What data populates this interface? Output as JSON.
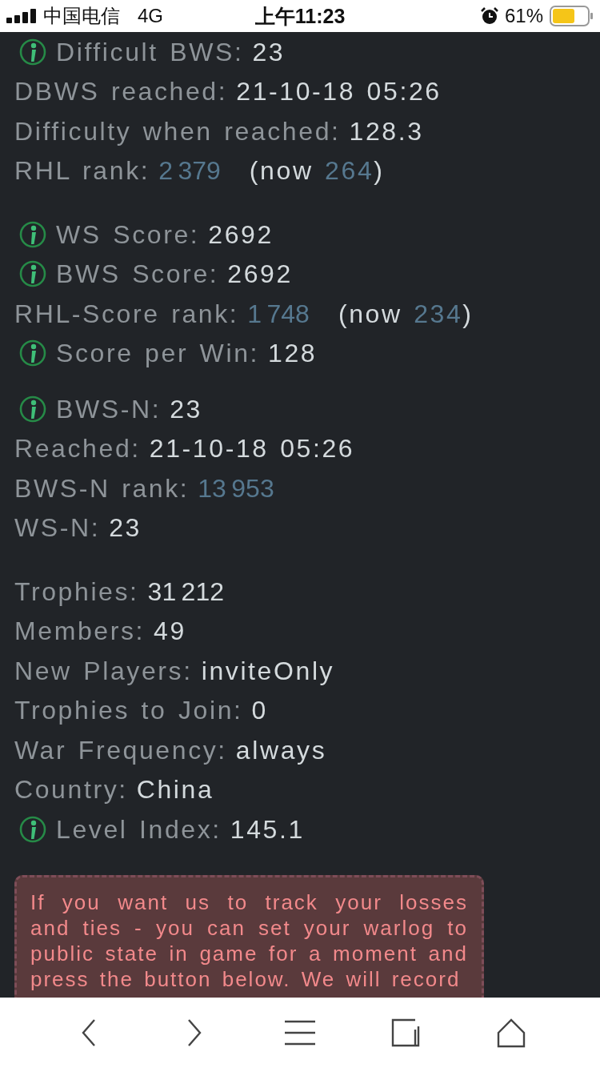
{
  "status_bar": {
    "carrier": "中国电信",
    "network": "4G",
    "time": "上午11:23",
    "battery": "61%"
  },
  "sections": [
    {
      "rows": [
        {
          "kind": "stat",
          "info": true,
          "label": "Difficult BWS:",
          "value": "23"
        },
        {
          "kind": "stat",
          "info": false,
          "label": "DBWS reached:",
          "value": "21-10-18 05:26"
        },
        {
          "kind": "stat",
          "info": false,
          "label": "Difficulty when reached:",
          "value": "128.3"
        },
        {
          "kind": "rank",
          "info": false,
          "label": "RHL rank:",
          "value": "2 379",
          "now_label": "(now",
          "now_value": "264",
          "now_close": ")"
        }
      ]
    },
    {
      "rows": [
        {
          "kind": "stat",
          "info": true,
          "label": "WS Score:",
          "value": "2692"
        },
        {
          "kind": "stat",
          "info": true,
          "label": "BWS Score:",
          "value": "2692"
        },
        {
          "kind": "rank",
          "info": false,
          "label": "RHL-Score rank:",
          "value": "1 748",
          "now_label": "(now",
          "now_value": "234",
          "now_close": ")"
        },
        {
          "kind": "stat",
          "info": true,
          "label": "Score per Win:",
          "value": "128"
        }
      ]
    },
    {
      "rows": [
        {
          "kind": "stat",
          "info": true,
          "label": "BWS-N:",
          "value": "23"
        },
        {
          "kind": "stat",
          "info": false,
          "label": "Reached:",
          "value": "21-10-18 05:26"
        },
        {
          "kind": "rank",
          "info": false,
          "label": "BWS-N rank:",
          "value": "13 953"
        },
        {
          "kind": "stat",
          "info": false,
          "label": "WS-N:",
          "value": "23"
        }
      ]
    },
    {
      "rows": [
        {
          "kind": "stat",
          "info": false,
          "label": "Trophies:",
          "value": "31 212"
        },
        {
          "kind": "stat",
          "info": false,
          "label": "Members:",
          "value": "49"
        },
        {
          "kind": "stat",
          "info": false,
          "label": "New Players:",
          "value": "inviteOnly"
        },
        {
          "kind": "stat",
          "info": false,
          "label": "Trophies to Join:",
          "value": "0"
        },
        {
          "kind": "stat",
          "info": false,
          "label": "War Frequency:",
          "value": "always"
        },
        {
          "kind": "stat",
          "info": false,
          "label": "Country:",
          "value": "China"
        },
        {
          "kind": "stat",
          "info": true,
          "label": "Level Index:",
          "value": "145.1"
        }
      ]
    }
  ],
  "alert": {
    "text": "If you want us to track your losses and ties - you can set your warlog to public state in game for a moment and press the button below. We will record"
  },
  "toolbar": {
    "buttons": [
      {
        "kind": "back"
      },
      {
        "kind": "forward"
      },
      {
        "kind": "menu"
      },
      {
        "kind": "tabs"
      },
      {
        "kind": "home"
      }
    ]
  }
}
